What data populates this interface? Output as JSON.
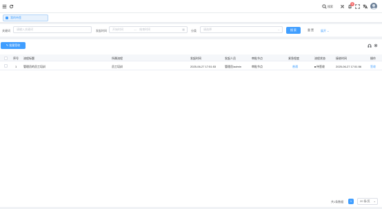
{
  "topbar": {
    "search_label": "搜索",
    "notification_count": "5"
  },
  "tabs": [
    {
      "label": "我的待签"
    }
  ],
  "filter": {
    "keyword_label": "关键词",
    "keyword_placeholder": "请输入关键词",
    "time_label": "发起时间",
    "time_start_placeholder": "开始时间",
    "time_separator": "—",
    "time_end_placeholder": "结束时间",
    "category_label": "分类",
    "category_placeholder": "请选择",
    "search_button": "搜 索",
    "reset_button": "重 置",
    "expand_link": "展开"
  },
  "toolbar": {
    "batch_sign_button": "批量签收"
  },
  "table": {
    "headers": [
      "序号",
      "流程标题",
      "所属流程",
      "发起时间",
      "发起人员",
      "审批节点",
      "紧急程度",
      "流程状态",
      "接收时间",
      "操作"
    ],
    "rows": [
      {
        "index": "1",
        "title": "管理员的员工培训",
        "process": "员工培训",
        "start_time": "2025-06-27 17:51:53",
        "initiator": "管理员/admin",
        "node": "审批节点",
        "urgency": "普通",
        "status": "待签收",
        "receive_time": "2025-06-27 17:51:56",
        "action": "签收"
      }
    ]
  },
  "pagination": {
    "total_text": "共1条数据",
    "current_page": "1",
    "page_size": "20 条/页"
  },
  "colors": {
    "primary": "#409eff",
    "badge": "#f56c6c"
  }
}
